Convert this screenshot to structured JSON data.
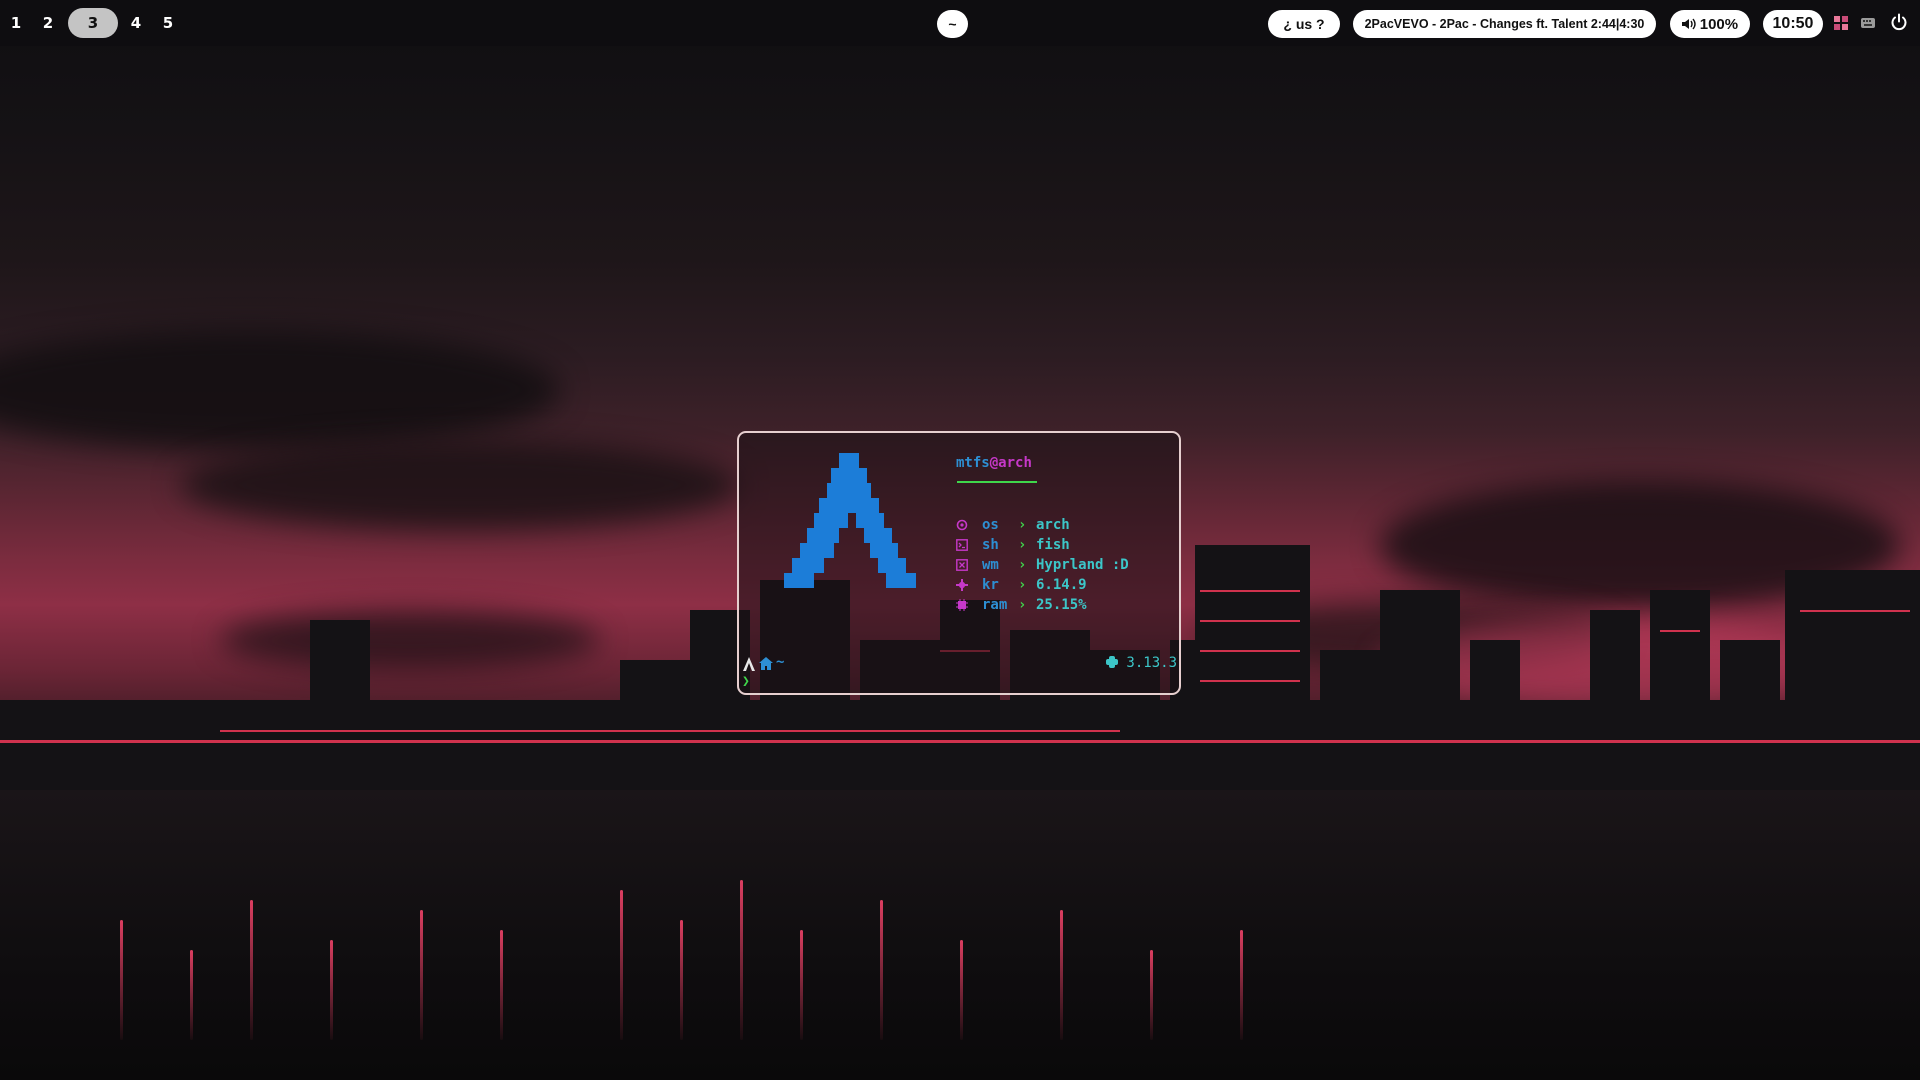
{
  "workspaces": [
    {
      "label": "1",
      "active": false
    },
    {
      "label": "2",
      "active": false
    },
    {
      "label": "3",
      "active": true
    },
    {
      "label": "4",
      "active": false
    },
    {
      "label": "5",
      "active": false
    }
  ],
  "center_button": "~",
  "status": {
    "keyboard": "¿ us ?",
    "media": "2PacVEVO - 2Pac - Changes ft. Talent 2:44|4:30",
    "volume": "100%",
    "clock": "10:50"
  },
  "icons": {
    "volume": "speaker-icon",
    "tray_1": "pinwheel-icon",
    "tray_2": "keyboard-icon",
    "power": "power-icon"
  },
  "terminal": {
    "user": "mtfs",
    "at": "@",
    "host": "arch",
    "info": [
      {
        "icon": "settings-icon",
        "key": "os",
        "value": "arch"
      },
      {
        "icon": "terminal-icon",
        "key": "sh",
        "value": "fish"
      },
      {
        "icon": "window-icon",
        "key": "wm",
        "value": "Hyprland :D"
      },
      {
        "icon": "gear-icon",
        "key": "kr",
        "value": "6.14.9"
      },
      {
        "icon": "chip-icon",
        "key": "ram",
        "value": "25.15%"
      }
    ],
    "prompt_dir": "~",
    "prompt_symbol": "❯",
    "python_version": "3.13.3"
  },
  "colors": {
    "accent_blue": "#1c7dd8",
    "key_blue": "#2d8fd3",
    "value_cyan": "#3cc6c8",
    "arrow_green": "#3fd64b",
    "icon_magenta": "#c638c9",
    "border": "#e6cfcf"
  }
}
